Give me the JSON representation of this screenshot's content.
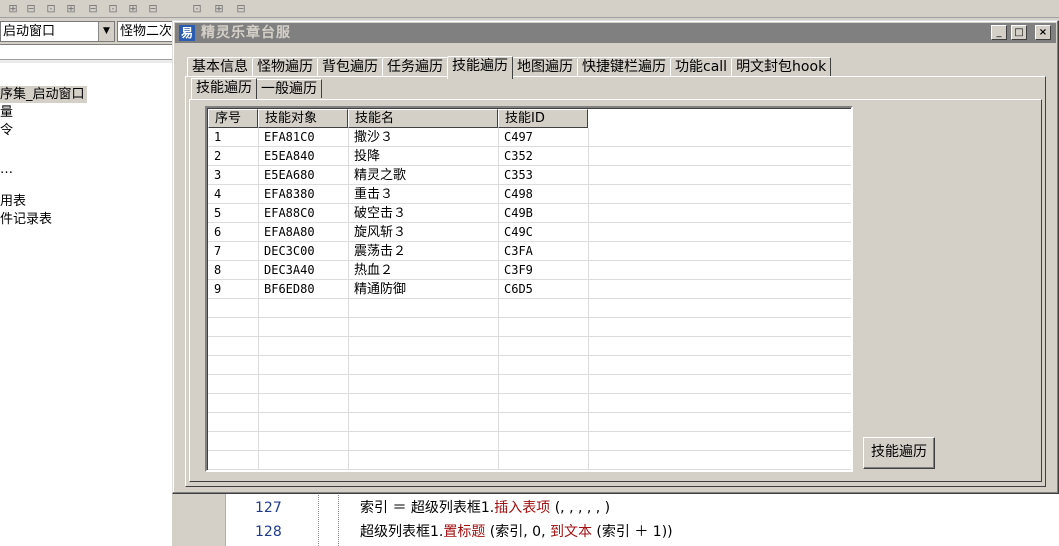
{
  "ide": {
    "combo_left": "启动窗口",
    "combo_right": "怪物二次",
    "tree": [
      "序集_启动窗口",
      "量",
      "令",
      "…",
      "用表",
      "件记录表"
    ],
    "code": [
      {
        "line": "127",
        "text_a": "索引 ＝ 超级列表框1.",
        "text_b": "插入表项",
        "text_c": " (, , , , , )"
      },
      {
        "line": "128",
        "text_a": "超级列表框1.",
        "text_b": "置标题",
        "text_c": " (索引, 0, ",
        "text_d": "到文本",
        "text_e": " (索引 ＋ 1))"
      }
    ]
  },
  "window": {
    "title": "精灵乐章台服",
    "icon_glyph": "易",
    "minimize": "_",
    "maximize": "□",
    "close": "×",
    "tabs": [
      "基本信息",
      "怪物遍历",
      "背包遍历",
      "任务遍历",
      "技能遍历",
      "地图遍历",
      "快捷键栏遍历",
      "功能call",
      "明文封包hook"
    ],
    "active_tab": "技能遍历",
    "subtabs": [
      "技能遍历",
      "一般遍历"
    ],
    "active_subtab": "技能遍历",
    "table": {
      "columns": [
        "序号",
        "技能对象",
        "技能名",
        "技能ID"
      ],
      "rows": [
        [
          "1",
          "EFA81C0",
          "撒沙３",
          "C497"
        ],
        [
          "2",
          "E5EA840",
          "投降",
          "C352"
        ],
        [
          "3",
          "E5EA680",
          "精灵之歌",
          "C353"
        ],
        [
          "4",
          "EFA8380",
          "重击３",
          "C498"
        ],
        [
          "5",
          "EFA88C0",
          "破空击３",
          "C49B"
        ],
        [
          "6",
          "EFA8A80",
          "旋风斩３",
          "C49C"
        ],
        [
          "7",
          "DEC3C00",
          "震荡击２",
          "C3FA"
        ],
        [
          "8",
          "DEC3A40",
          "热血２",
          "C3F9"
        ],
        [
          "9",
          "BF6ED80",
          "精通防御",
          "C6D5"
        ]
      ]
    },
    "action_button": "技能遍历"
  }
}
